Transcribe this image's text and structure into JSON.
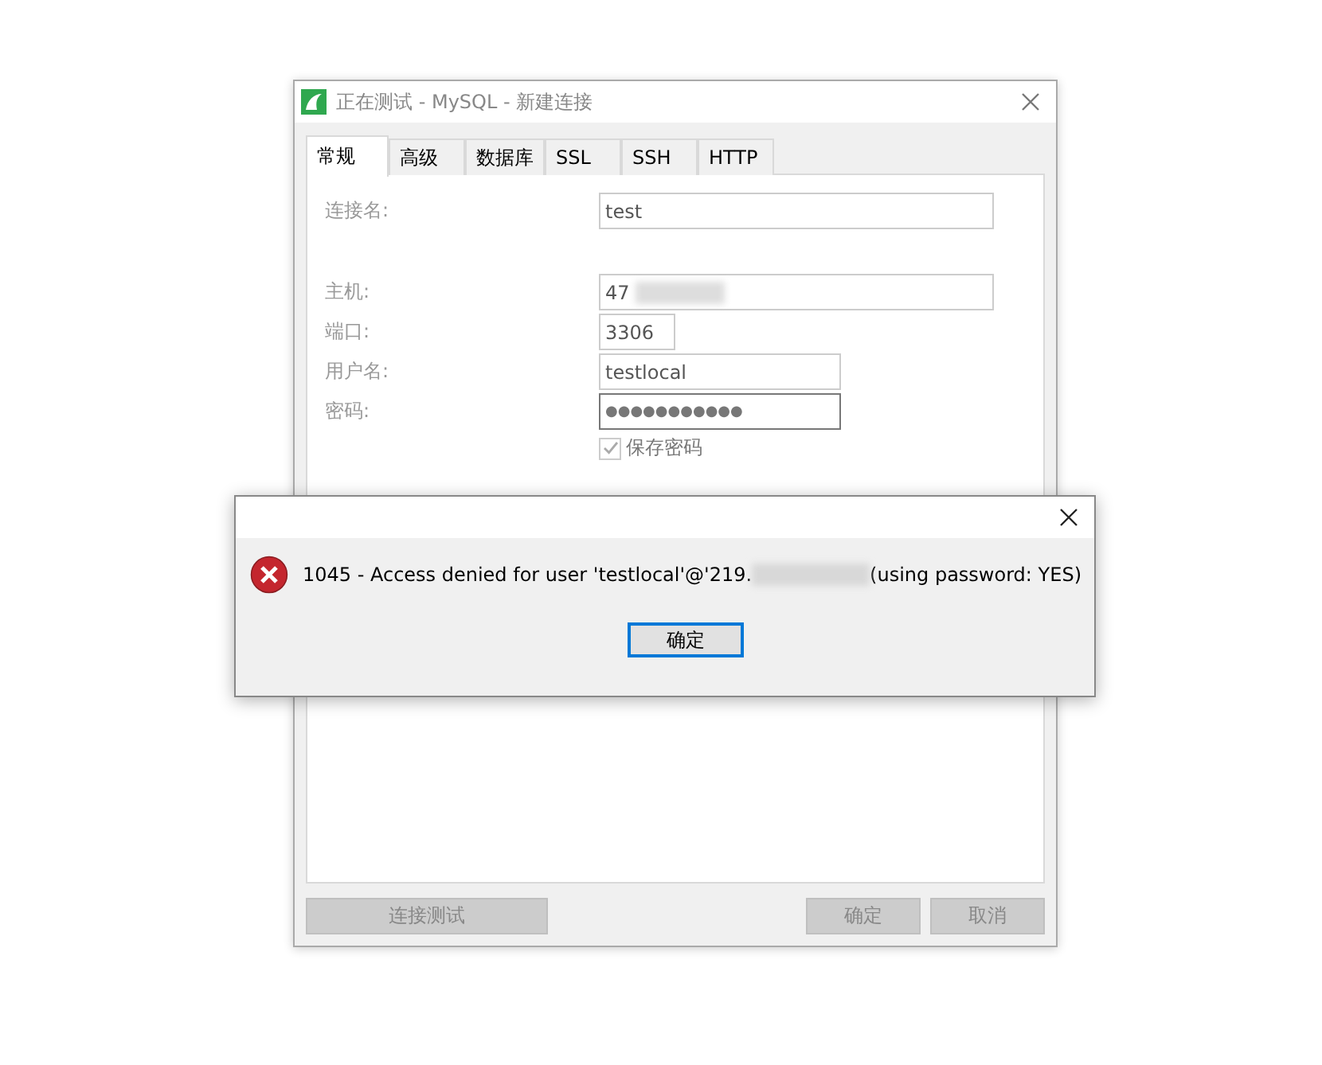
{
  "window": {
    "title": "正在测试 - MySQL - 新建连接"
  },
  "tabs": [
    {
      "label": "常规",
      "selected": true
    },
    {
      "label": "高级",
      "selected": false
    },
    {
      "label": "数据库",
      "selected": false
    },
    {
      "label": "SSL",
      "selected": false
    },
    {
      "label": "SSH",
      "selected": false
    },
    {
      "label": "HTTP",
      "selected": false
    }
  ],
  "form": {
    "disabled": true,
    "fields": [
      {
        "label": "连接名:",
        "value": "test",
        "kind": "wide"
      },
      {
        "label": "主机:",
        "value": "47",
        "kind": "wide",
        "redacted": true
      },
      {
        "label": "端口:",
        "value": "3306",
        "kind": "short"
      },
      {
        "label": "用户名:",
        "value": "testlocal",
        "kind": "medium"
      },
      {
        "label": "密码:",
        "value": "●●●●●●●●●●●",
        "kind": "password"
      }
    ],
    "save_password": {
      "label": "保存密码",
      "checked": true
    }
  },
  "buttons": [
    {
      "label": "连接测试",
      "disabled": true
    },
    {
      "label": "确定",
      "disabled": true
    },
    {
      "label": "取消",
      "disabled": true
    }
  ],
  "error_dialog": {
    "message_start": "1045 - Access denied for user 'testlocal'@'219.",
    "message_end": "(using password: YES)",
    "button": "确定"
  }
}
